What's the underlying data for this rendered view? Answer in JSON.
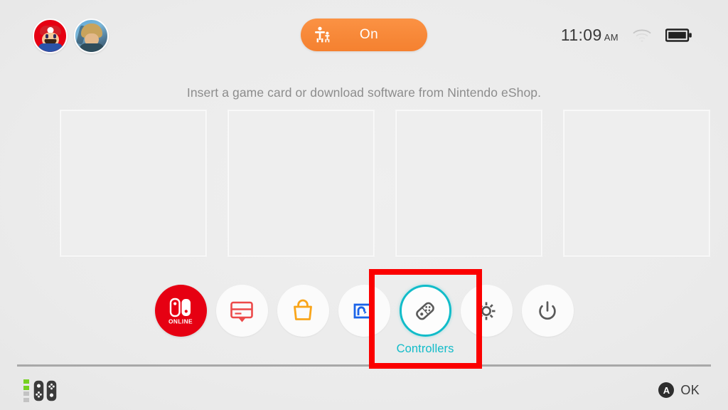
{
  "system": {
    "background_color": "#ebebeb",
    "accent_selected": "#11bcc9",
    "annotation_color": "#fb0000"
  },
  "topbar": {
    "avatars": [
      {
        "name": "Mario",
        "icon": "mario-avatar"
      },
      {
        "name": "Link",
        "icon": "link-avatar"
      }
    ],
    "parental_controls": {
      "label": "On",
      "icon": "parental-controls-icon",
      "color": "#f78838"
    },
    "status": {
      "time": "11:09",
      "ampm": "AM",
      "wifi_icon": "wifi-icon",
      "wifi_state": "weak",
      "battery_icon": "battery-icon",
      "battery_state": "full"
    }
  },
  "main": {
    "hint_text": "Insert a game card or download software from Nintendo eShop.",
    "tiles": [
      {
        "id": "tile-1",
        "label": ""
      },
      {
        "id": "tile-2",
        "label": ""
      },
      {
        "id": "tile-3",
        "label": ""
      },
      {
        "id": "tile-4",
        "label": ""
      },
      {
        "id": "tile-5",
        "label": ""
      }
    ]
  },
  "dock": {
    "items": [
      {
        "id": "online",
        "icon": "nintendo-switch-online-icon",
        "label": "",
        "selected": false,
        "badge": "ONLINE"
      },
      {
        "id": "news",
        "icon": "news-icon",
        "label": "",
        "selected": false
      },
      {
        "id": "eshop",
        "icon": "eshop-bag-icon",
        "label": "",
        "selected": false
      },
      {
        "id": "album",
        "icon": "album-icon",
        "label": "",
        "selected": false
      },
      {
        "id": "controllers",
        "icon": "controllers-icon",
        "label": "Controllers",
        "selected": true
      },
      {
        "id": "settings",
        "icon": "settings-gear-icon",
        "label": "",
        "selected": false
      },
      {
        "id": "power",
        "icon": "power-icon",
        "label": "",
        "selected": false
      }
    ]
  },
  "bottom": {
    "controller_battery_segments": 2,
    "controller_battery_total": 4,
    "controller_icon": "joy-con-pair-icon",
    "confirm": {
      "button": "A",
      "label": "OK"
    }
  }
}
